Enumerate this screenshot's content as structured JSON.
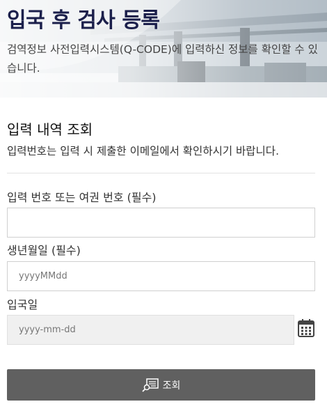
{
  "banner": {
    "title": "입국 후 검사 등록",
    "description": "검역정보 사전입력시스템(Q-CODE)에 입력하신 정보를 확인할 수 있습니다."
  },
  "section": {
    "title": "입력 내역 조회",
    "description": "입력번호는 입력 시 제출한 이메일에서 확인하시기 바랍니다."
  },
  "form": {
    "id_label": "입력 번호 또는 여권 번호 (필수)",
    "id_value": "",
    "birth_label": "생년월일 (필수)",
    "birth_placeholder": "yyyyMMdd",
    "entry_label": "입국일",
    "entry_placeholder": "yyyy-mm-dd",
    "calendar_icon": "calendar-icon",
    "submit_label": "조회",
    "submit_icon": "search-document-icon"
  },
  "colors": {
    "title": "#1b1f4b",
    "button": "#606060",
    "disabled_input": "#f0f0f0"
  }
}
